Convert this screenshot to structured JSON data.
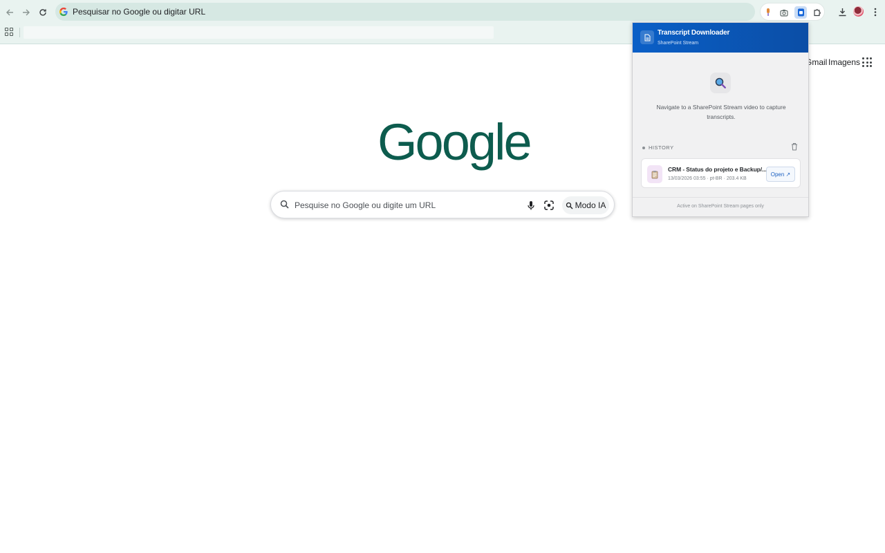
{
  "browser": {
    "omnibox_text": "Pesquisar no Google ou digitar URL",
    "extensions": [
      "voice-ext-icon",
      "camera-icon",
      "transcript-ext-icon",
      "puzzle-icon"
    ],
    "toolbar": [
      "download-icon",
      "avatar",
      "kebab-menu-icon"
    ]
  },
  "google": {
    "links": {
      "gmail": "Gmail",
      "images": "Imagens"
    },
    "logo": "Google",
    "search_placeholder": "Pesquise no Google ou digite um URL",
    "ai_mode": "Modo IA"
  },
  "popup": {
    "title": "Transcript Downloader",
    "subtitle": "SharePoint Stream",
    "empty_message": "Navigate to a SharePoint Stream video to capture transcripts.",
    "history_label": "HISTORY",
    "history": [
      {
        "title": "CRM - Status do projeto e Backup/...",
        "meta": "13/03/2026 03:55 · pt-BR · 203.4 KB",
        "open_label": "Open ↗"
      }
    ],
    "footer": "Active on SharePoint Stream pages only"
  },
  "colors": {
    "accent": "#0a5fc7",
    "chrome": "#e9f3f0",
    "logo": "#0d5c4e"
  }
}
